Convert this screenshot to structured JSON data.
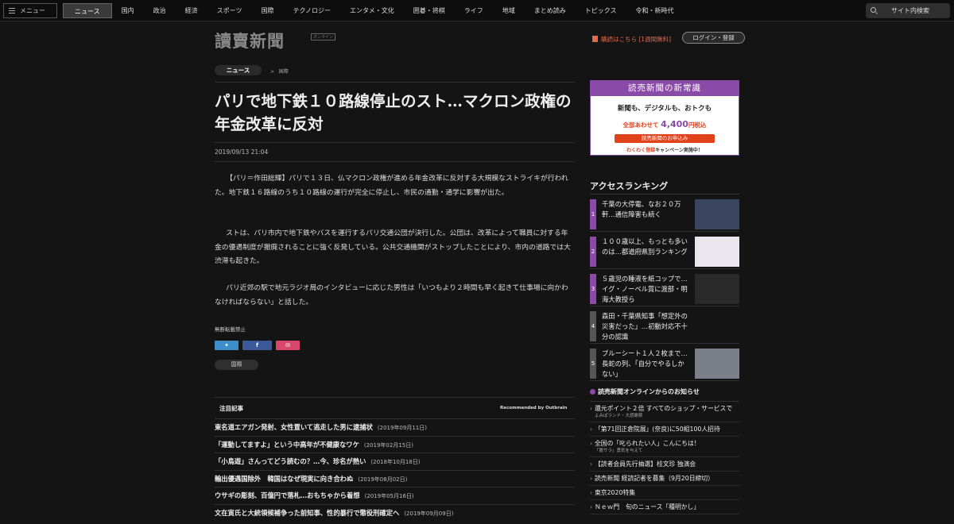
{
  "nav": {
    "menu_label": "メニュー",
    "items": [
      "ニュース",
      "国内",
      "政治",
      "経済",
      "スポーツ",
      "国際",
      "テクノロジー",
      "エンタメ・文化",
      "囲碁・将棋",
      "ライフ",
      "地域",
      "まとめ読み",
      "トピックス",
      "令和・新時代"
    ],
    "active_index": 0,
    "search_label": "サイト内検索"
  },
  "header": {
    "logo": "讀賣新聞",
    "logo_sub": "オンライン",
    "subscribe": "購読はこちら [1週間無料]",
    "login": "ログイン・登録"
  },
  "breadcrumb": {
    "section": "ニュース",
    "sub": "国際"
  },
  "article": {
    "title": "パリで地下鉄１０路線停止のスト…マクロン政権の年金改革に反対",
    "date": "2019/09/13 21:04",
    "paragraphs": [
      "【パリ＝作田総輝】パリで１３日、仏マクロン政権が進める年金改革に反対する大規模なストライキが行われた。地下鉄１６路線のうち１０路線の運行が完全に停止し、市民の通勤・通学に影響が出た。",
      "ストは、パリ市内で地下鉄やバスを運行するパリ交通公団が決行した。公団は、改革によって職員に対する年金の優遇制度が撤廃されることに強く反発している。公共交通機関がストップしたことにより、市内の道路では大渋滞も起きた。",
      "パリ近郊の駅で地元ラジオ局のインタビューに応じた男性は「いつもより２時間も早く起きて仕事場に向かわなければならない」と話した。"
    ],
    "copyright": "無断転載禁止",
    "tag": "国際"
  },
  "featured": {
    "heading": "注目記事",
    "provider": "Recommended by Outbrain",
    "items": [
      {
        "title": "東名道エアガン発射、女性置いて逃走した男に逮捕状",
        "date": "(2019年09月11日)"
      },
      {
        "title": "「運動してますよ」という中高年が不健康なワケ",
        "date": "(2019年02月15日)"
      },
      {
        "title": "「小鳥遊」さんってどう読むの？…今、珍名が熱い",
        "date": "(2018年10月18日)"
      },
      {
        "title": "輸出優遇国除外　韓国はなぜ現実に向き合わぬ",
        "date": "(2019年08月02日)"
      },
      {
        "title": "ウサギの彫刻、百億円で落札…おもちゃから着想",
        "date": "(2019年05月16日)"
      },
      {
        "title": "文在寅氏と大統領候補争った前知事、性的暴行で懲役刑確定へ",
        "date": "(2019年09月09日)"
      }
    ]
  },
  "ad": {
    "head": "読売新聞の新常識",
    "row1": "新聞も、デジタルも、おトクも",
    "row2_prefix": "全部あわせて",
    "row2_price": "4,400",
    "row2_suffix": "円税込",
    "button": "読売新聞のお申込み",
    "row3_prefix": "わくわく登録",
    "row3_suffix": "キャンペーン実施中！"
  },
  "ranking": {
    "heading": "アクセスランキング",
    "items": [
      {
        "num": "1",
        "text": "千葉の大停電、なお２０万軒…通信障害も続く",
        "thumb": "#3a4660"
      },
      {
        "num": "2",
        "text": "１００歳以上、もっとも多いのは…都道府県別ランキング",
        "thumb": "#e9e6ee"
      },
      {
        "num": "3",
        "text": "５歳児の睡液を紙コップで…イグ・ノーベル賞に渡部・明海大教授ら",
        "thumb": "#2a2a2a"
      },
      {
        "num": "4",
        "text": "森田・千葉県知事「想定外の災害だった」…初動対応不十分の認識",
        "thumb": ""
      },
      {
        "num": "5",
        "text": "ブルーシート１人２枚まで…長蛇の列、「自分でやるしかない」",
        "thumb": "#7a7f88"
      }
    ]
  },
  "notices": {
    "heading": "読売新聞オンラインからのお知らせ",
    "items": [
      {
        "text": "還元ポイント２倍 すべてのショップ・サービスで",
        "sub": "よみぽランド・大感謝祭"
      },
      {
        "text": "「第71回正倉院展」(奈良)に50組100人招待",
        "sub": ""
      },
      {
        "text": "全国の「叱られたい人」こんにちは！",
        "sub": "「脱サラ」勇気を与えて"
      },
      {
        "text": "【読者会員先行抽選】桂文珍 独演会",
        "sub": ""
      },
      {
        "text": "読売新聞 経読記者を募集（9月20日締切）",
        "sub": ""
      },
      {
        "text": "東京2020特集",
        "sub": ""
      },
      {
        "text": "Ｎｅｗ門　旬のニュース「種明かし」",
        "sub": ""
      }
    ]
  },
  "colors": {
    "accent": "#8a4aa8",
    "twitter": "#3d8ec9",
    "facebook": "#3b5998",
    "mail": "#d9486a"
  }
}
